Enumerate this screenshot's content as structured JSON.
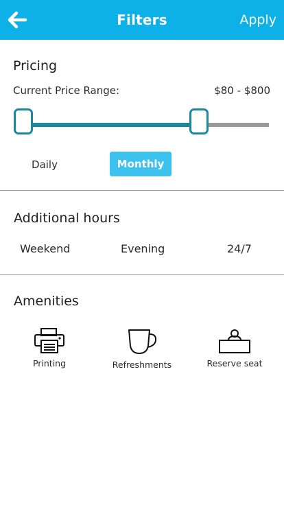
{
  "header": {
    "title": "Filters",
    "apply_label": "Apply"
  },
  "pricing": {
    "section_title": "Pricing",
    "range_label": "Current Price Range:",
    "range_value": "$80 - $800",
    "slider": {
      "low_fraction": 0.0,
      "high_fraction": 0.74
    },
    "period_options": [
      {
        "label": "Daily",
        "selected": false
      },
      {
        "label": "Monthly",
        "selected": true
      }
    ]
  },
  "hours": {
    "section_title": "Additional hours",
    "options": [
      {
        "label": "Weekend"
      },
      {
        "label": "Evening"
      },
      {
        "label": "24/7"
      }
    ]
  },
  "amenities": {
    "section_title": "Amenities",
    "items": [
      {
        "label": "Printing",
        "icon": "printer-icon"
      },
      {
        "label": "Refreshments",
        "icon": "cup-icon"
      },
      {
        "label": "Reserve seat",
        "icon": "reserve-seat-icon"
      }
    ]
  },
  "colors": {
    "header_bg": "#0eb0e8",
    "slider_active": "#178aa0",
    "slider_inactive": "#999999",
    "selected_button": "#3cc2ef"
  }
}
